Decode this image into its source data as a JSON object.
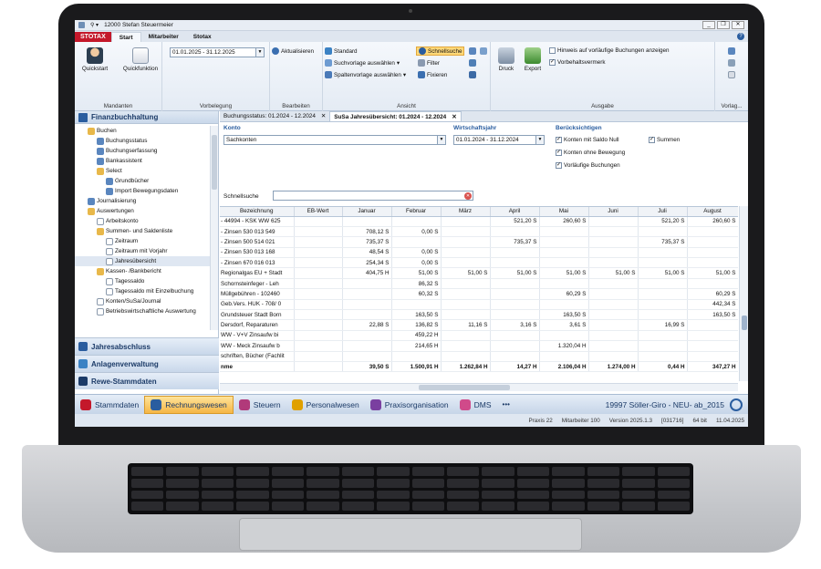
{
  "window": {
    "title": "12000 Stefan Steuermeier",
    "controls": [
      "_",
      "❐",
      "✕"
    ]
  },
  "ribbon": {
    "logo": "STOTAX",
    "tabs": [
      "Start",
      "Mitarbeiter",
      "Stotax"
    ],
    "mandanten": {
      "quickstart": "Quickstart",
      "quickfunktion": "Quickfunktion",
      "label": "Mandanten"
    },
    "vorbelegung": {
      "period": "01.01.2025 - 31.12.2025",
      "label": "Vorbelegung"
    },
    "bearbeiten": {
      "aktualisieren": "Aktualisieren",
      "label": "Bearbeiten"
    },
    "ansicht": {
      "standard": "Standard",
      "suchvorlage": "Suchvorlage auswählen",
      "spaltenvorlage": "Spaltenvorlage auswählen",
      "schnellsuche": "Schnellsuche",
      "filter": "Filter",
      "fixieren": "Fixieren",
      "label": "Ansicht"
    },
    "ausgabe": {
      "druck": "Druck",
      "export": "Export",
      "hinweis": "Hinweis auf vorläufige Buchungen anzeigen",
      "vorbehalt": "Vorbehaltsvermerk",
      "label": "Ausgabe",
      "vorlage": "Vorlag..."
    }
  },
  "sidebar": {
    "title": "Finanzbuchhaltung",
    "tree": [
      {
        "label": "Buchen",
        "indent": 1,
        "icon": "folder-open-icon"
      },
      {
        "label": "Buchungsstatus",
        "indent": 2,
        "icon": "grid-icon"
      },
      {
        "label": "Buchungserfassung",
        "indent": 2,
        "icon": "grid-icon"
      },
      {
        "label": "Bankassistent",
        "indent": 2,
        "icon": "grid-icon"
      },
      {
        "label": "Select",
        "indent": 2,
        "icon": "folder-open-icon"
      },
      {
        "label": "Grundbücher",
        "indent": 3,
        "icon": "grid-icon"
      },
      {
        "label": "Import Bewegungsdaten",
        "indent": 3,
        "icon": "grid-icon"
      },
      {
        "label": "Journalisierung",
        "indent": 1,
        "icon": "grid-icon"
      },
      {
        "label": "Auswertungen",
        "indent": 1,
        "icon": "folder-open-icon"
      },
      {
        "label": "Arbeitskonto",
        "indent": 2,
        "icon": "doc-icon"
      },
      {
        "label": "Summen- und Saldenliste",
        "indent": 2,
        "icon": "folder-open-icon"
      },
      {
        "label": "Zeitraum",
        "indent": 3,
        "icon": "doc-icon"
      },
      {
        "label": "Zeitraum mit Vorjahr",
        "indent": 3,
        "icon": "doc-icon"
      },
      {
        "label": "Jahresübersicht",
        "indent": 3,
        "icon": "doc-icon",
        "selected": true
      },
      {
        "label": "Kassen- /Bankbericht",
        "indent": 2,
        "icon": "folder-open-icon"
      },
      {
        "label": "Tagessaldo",
        "indent": 3,
        "icon": "doc-icon"
      },
      {
        "label": "Tagessaldo mit Einzelbuchung",
        "indent": 3,
        "icon": "doc-icon"
      },
      {
        "label": "Konten/SuSa/Journal",
        "indent": 2,
        "icon": "doc-icon"
      },
      {
        "label": "Betriebswirtschaftliche Auswertung",
        "indent": 2,
        "icon": "doc-icon"
      }
    ],
    "nav": [
      "Jahresabschluss",
      "Anlagenverwaltung",
      "Rewe-Stammdaten"
    ]
  },
  "doc_tabs": [
    {
      "label": "Buchungsstatus: 01.2024 - 12.2024",
      "active": false
    },
    {
      "label": "SuSa Jahresübersicht: 01.2024 - 12.2024",
      "active": true
    }
  ],
  "filters": {
    "konto_label": "Konto",
    "konto_value": "Sachkonten",
    "wj_label": "Wirtschaftsjahr",
    "wj_value": "01.01.2024 - 31.12.2024",
    "beruecksichtigen_label": "Berücksichtigen",
    "options": [
      {
        "label": "Konten mit Saldo Null",
        "checked": true
      },
      {
        "label": "Summen",
        "checked": true
      },
      {
        "label": "Konten ohne Bewegung",
        "checked": true
      },
      {
        "label": "Vorläufige Buchungen",
        "checked": true
      }
    ],
    "schnellsuche_label": "Schnellsuche",
    "schnellsuche_value": ""
  },
  "table": {
    "columns": [
      "Bezeichnung",
      "EB-Wert",
      "Januar",
      "Februar",
      "März",
      "April",
      "Mai",
      "Juni",
      "Juli",
      "August"
    ],
    "rows": [
      [
        "- 44994 - KSK WW 625",
        "",
        "",
        "",
        "",
        "521,20 S",
        "260,60 S",
        "",
        "521,20 S",
        "260,60 S"
      ],
      [
        "- Zinsen 530 013 549",
        "",
        "708,12 S",
        "0,00 S",
        "",
        "",
        "",
        "",
        "",
        ""
      ],
      [
        "- Zinsen 500 514 021",
        "",
        "735,37 S",
        "",
        "",
        "735,37 S",
        "",
        "",
        "735,37 S",
        ""
      ],
      [
        "- Zinsen 530 013 168",
        "",
        "48,54 S",
        "0,00 S",
        "",
        "",
        "",
        "",
        "",
        ""
      ],
      [
        "- Zinsen 670 016 013",
        "",
        "254,34 S",
        "0,00 S",
        "",
        "",
        "",
        "",
        "",
        ""
      ],
      [
        "Regionalgas EU + Stadt",
        "",
        "404,75 H",
        "51,00 S",
        "51,00 S",
        "51,00 S",
        "51,00 S",
        "51,00 S",
        "51,00 S",
        "51,00 S"
      ],
      [
        "Schornsteinfeger - Leh",
        "",
        "",
        "86,32 S",
        "",
        "",
        "",
        "",
        "",
        ""
      ],
      [
        "Müllgebühren - 102460",
        "",
        "",
        "60,32 S",
        "",
        "",
        "60,29 S",
        "",
        "",
        "60,29 S"
      ],
      [
        "Geb.Vers. HUK - 708/ 0",
        "",
        "",
        "",
        "",
        "",
        "",
        "",
        "",
        "442,34 S"
      ],
      [
        "Grundsteuer Stadt Born",
        "",
        "",
        "163,50 S",
        "",
        "",
        "163,50 S",
        "",
        "",
        "163,50 S"
      ],
      [
        "Dersdorf, Reparaturen",
        "",
        "22,88 S",
        "136,82 S",
        "11,16 S",
        "3,16 S",
        "3,61 S",
        "",
        "16,99 S",
        ""
      ],
      [
        "WW - V+V Zinsaufw bi",
        "",
        "",
        "459,22 H",
        "",
        "",
        "",
        "",
        "",
        ""
      ],
      [
        "WW - Meck Zinsaufw b",
        "",
        "",
        "214,65 H",
        "",
        "",
        "1.320,04 H",
        "",
        "",
        ""
      ],
      [
        "schriften, Bücher (Fachlit",
        "",
        "",
        "",
        "",
        "",
        "",
        "",
        "",
        ""
      ]
    ],
    "total": [
      "nme",
      "",
      "39,50 S",
      "1.500,91 H",
      "1.262,84 H",
      "14,27 H",
      "2.106,04 H",
      "1.274,00 H",
      "0,44 H",
      "347,27 H"
    ]
  },
  "modules": [
    {
      "label": "Stammdaten",
      "active": false,
      "color": "#c4182b",
      "icon": "stammdaten-icon"
    },
    {
      "label": "Rechnungswesen",
      "active": true,
      "color": "#2a5d9f",
      "icon": "rechnungswesen-icon"
    },
    {
      "label": "Steuern",
      "active": false,
      "color": "#b13a7a",
      "icon": "steuern-icon"
    },
    {
      "label": "Personalwesen",
      "active": false,
      "color": "#e0a000",
      "icon": "personalwesen-icon"
    },
    {
      "label": "Praxisorganisation",
      "active": false,
      "color": "#7a3fa0",
      "icon": "praxis-icon"
    },
    {
      "label": "DMS",
      "active": false,
      "color": "#d04a8a",
      "icon": "dms-icon"
    }
  ],
  "modules_more": "•••",
  "client_info": "19997 Söller-Giro - NEU- ab_2015",
  "status": [
    "Praxis 22",
    "Mitarbeiter 100",
    "Version 2025.1.3",
    "[031716]",
    "64 bit",
    "11.04.2025"
  ],
  "colors": {
    "accent": "#2a5d9f",
    "brand": "#c4182b",
    "highlight": "#ffd979"
  }
}
